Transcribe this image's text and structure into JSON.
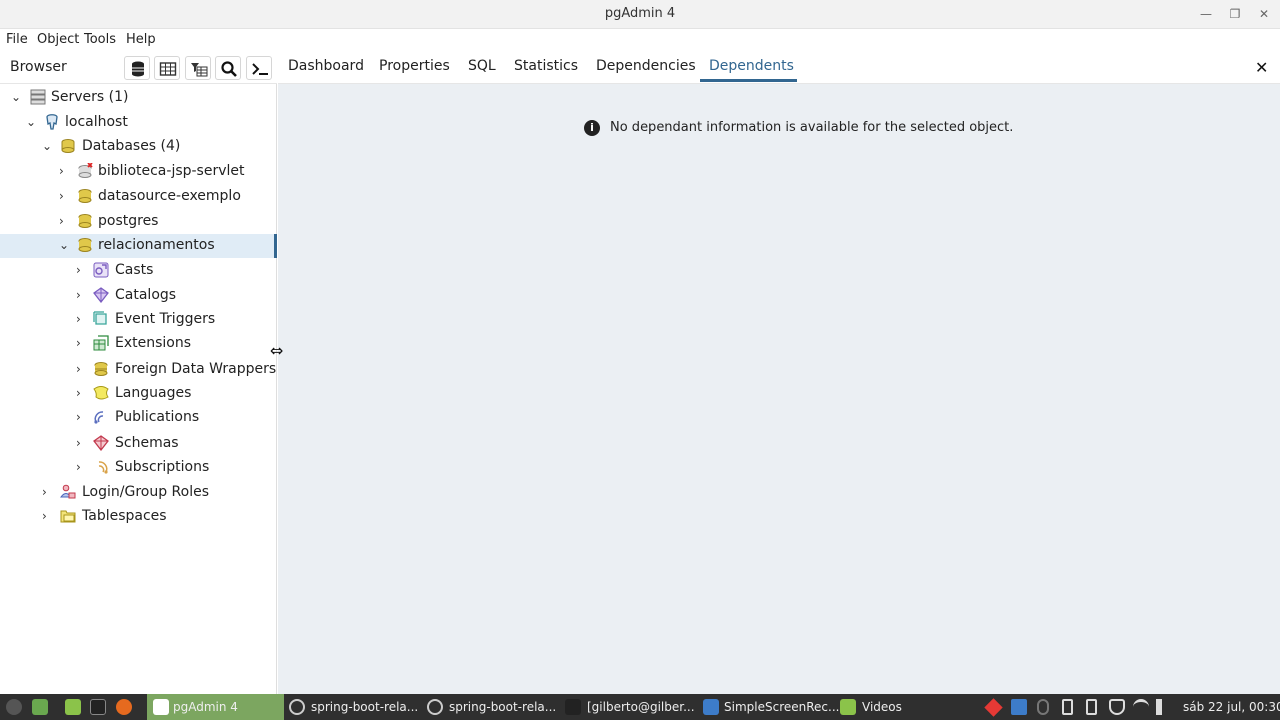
{
  "window": {
    "title": "pgAdmin 4"
  },
  "menu": [
    "File",
    "Object",
    "Tools",
    "Help"
  ],
  "browser": {
    "title": "Browser"
  },
  "tabs": [
    "Dashboard",
    "Properties",
    "SQL",
    "Statistics",
    "Dependencies",
    "Dependents"
  ],
  "active_tab": "Dependents",
  "tree": [
    {
      "label": "Servers (1)",
      "icon": "servers-icon",
      "expanded": true
    },
    {
      "label": "localhost",
      "icon": "postgres-server-icon",
      "expanded": true
    },
    {
      "label": "Databases (4)",
      "icon": "databases-icon",
      "expanded": true
    },
    {
      "label": "biblioteca-jsp-servlet",
      "icon": "database-disconnected-icon",
      "expanded": false
    },
    {
      "label": "datasource-exemplo",
      "icon": "database-icon",
      "expanded": false
    },
    {
      "label": "postgres",
      "icon": "database-icon",
      "expanded": false
    },
    {
      "label": "relacionamentos",
      "icon": "database-icon",
      "expanded": true,
      "selected": true
    },
    {
      "label": "Casts",
      "icon": "casts-icon",
      "expanded": false
    },
    {
      "label": "Catalogs",
      "icon": "catalogs-icon",
      "expanded": false
    },
    {
      "label": "Event Triggers",
      "icon": "event-triggers-icon",
      "expanded": false
    },
    {
      "label": "Extensions",
      "icon": "extensions-icon",
      "expanded": false
    },
    {
      "label": "Foreign Data Wrappers",
      "icon": "fdw-icon",
      "expanded": false
    },
    {
      "label": "Languages",
      "icon": "languages-icon",
      "expanded": false
    },
    {
      "label": "Publications",
      "icon": "publications-icon",
      "expanded": false
    },
    {
      "label": "Schemas",
      "icon": "schemas-icon",
      "expanded": false
    },
    {
      "label": "Subscriptions",
      "icon": "subscriptions-icon",
      "expanded": false
    },
    {
      "label": "Login/Group Roles",
      "icon": "roles-icon",
      "expanded": false
    },
    {
      "label": "Tablespaces",
      "icon": "tablespaces-icon",
      "expanded": false
    }
  ],
  "main": {
    "message": "No dependant information is available for the selected object."
  },
  "taskbar": {
    "items": [
      "pgAdmin 4",
      "spring-boot-rela...",
      "spring-boot-rela...",
      "[gilberto@gilber...",
      "SimpleScreenRec...",
      "Videos"
    ],
    "clock": "sáb 22 jul, 00:30"
  },
  "colors": {
    "accent": "#326690",
    "selected_bg": "#e0ecf6",
    "content_bg": "#ebeff3",
    "taskbar_active": "#7ca660"
  }
}
